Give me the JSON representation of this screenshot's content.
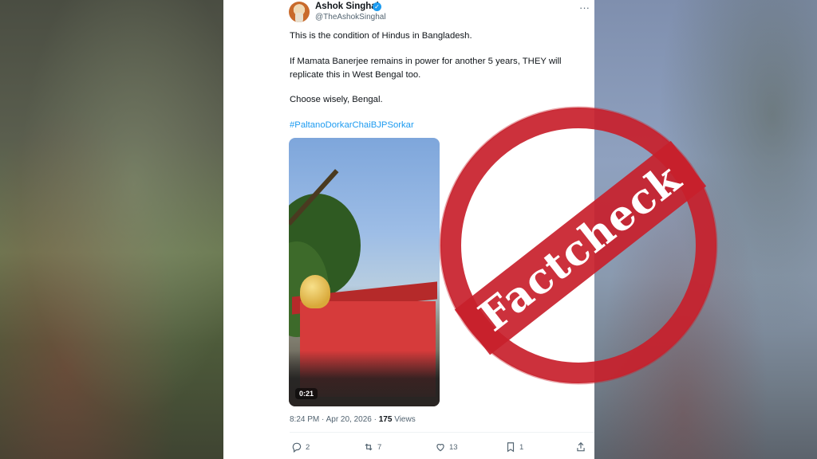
{
  "post": {
    "author_name": "Ashok Singhal",
    "author_handle": "@TheAshokSinghal",
    "line1": "This is the condition of Hindus in Bangladesh.",
    "line2": "If Mamata Banerjee remains in power for another 5 years, THEY will",
    "line3": "replicate this in West Bengal too.",
    "line4": "Choose wisely, Bengal.",
    "hashtag": "#PaltanoDorkarChaiBJPSorkar",
    "video_time": "0:21",
    "time": "8:24 PM",
    "date": "Apr 20, 2026",
    "views_count": "175",
    "views_label": "Views"
  },
  "actions": {
    "replies": "2",
    "reposts": "7",
    "likes": "13",
    "bookmarks": "1"
  },
  "stamp": {
    "text": "Factcheck",
    "color": "#c8202b"
  },
  "icons": {
    "verified": "verified-badge-icon",
    "more": "more-icon",
    "reply": "reply-icon",
    "repost": "repost-icon",
    "like": "heart-icon",
    "bookmark": "bookmark-icon",
    "share": "share-icon"
  }
}
